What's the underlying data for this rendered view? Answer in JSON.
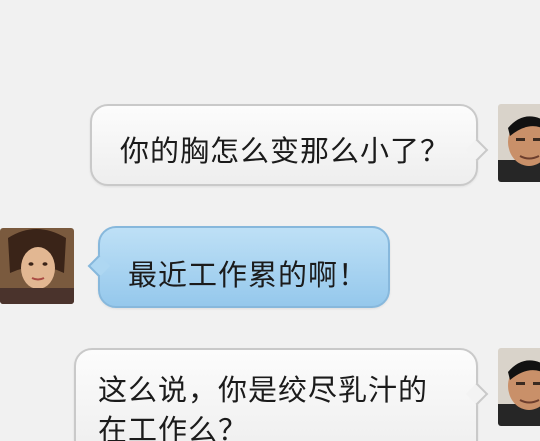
{
  "messages": [
    {
      "side": "right",
      "avatar": "male-avatar-icon",
      "lines": [
        "你的胸怎么变那么小了？"
      ]
    },
    {
      "side": "left",
      "avatar": "female-avatar-icon",
      "lines": [
        "最近工作累的啊！"
      ]
    },
    {
      "side": "right",
      "avatar": "male-avatar-icon",
      "lines": [
        "这么说，你是绞尽乳汁的",
        "在工作么？"
      ]
    }
  ],
  "colors": {
    "background": "#f1f1f1",
    "outgoing_bubble": "#f3f3f3",
    "incoming_bubble": "#aed7f2"
  }
}
